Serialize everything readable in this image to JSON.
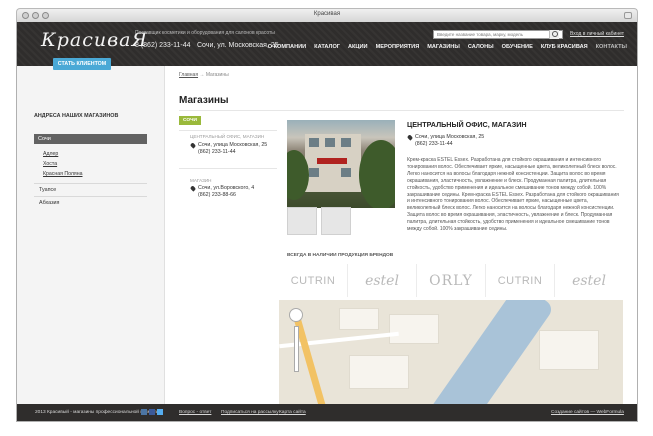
{
  "browser": {
    "title": "Красивая"
  },
  "header": {
    "logo": "КрасиваЯ",
    "tagline": "Поставщик косметики и оборудования для салонов красоты",
    "phone": "8 (862) 233-11-44",
    "address": "Сочи, ул. Московская, 25",
    "search_placeholder": "Введите название товара, марку, модель",
    "login_link": "Вход в личный кабинет",
    "nav": [
      "О КОМПАНИИ",
      "КАТАЛОГ",
      "АКЦИИ",
      "МЕРОПРИЯТИЯ",
      "МАГАЗИНЫ",
      "САЛОНЫ",
      "ОБУЧЕНИЕ",
      "КЛУБ КРАСИВАЯ",
      "КОНТАКТЫ"
    ]
  },
  "sidebar": {
    "become_client": "СТАТЬ КЛИЕНТОМ",
    "title": "АНДРЕСА НАШИХ МАГАЗИНОВ",
    "active_city": "Сочи",
    "sub_items": [
      "Адлер",
      "Хоста",
      "Красная Поляна"
    ],
    "cities": [
      "Туапсе",
      "Абхазия"
    ]
  },
  "main": {
    "breadcrumb_home": "Главная",
    "breadcrumb_sep": "→",
    "breadcrumb_current": "Магазины",
    "page_title": "Магазины",
    "tag": "СОЧИ",
    "offices": [
      {
        "caption": "ЦЕНТРАЛЬНЫЙ ОФИС, МАГАЗИН",
        "address": "Сочи, улица Московская, 25",
        "phone": "(862) 233-11-44"
      },
      {
        "caption": "МАГАЗИН",
        "address": "Сочи, ул.Воровского, 4",
        "phone": "(862) 233-88-66"
      }
    ],
    "detail": {
      "title": "ЦЕНТРАЛЬНЫЙ ОФИС, МАГАЗИН",
      "address": "Сочи, улица Московская, 25",
      "phone": "(862) 233-11-44",
      "description": "Крем-краска ESTEL Essex. Разработана для стойкого окрашивания и интенсивного тонирования волос. Обеспечивает яркие, насыщенные цвета, великолепный блеск волос. Легко наносится на волосы благодаря нежной консистенции. Защита волос во время окрашивания, эластичность, увлажнение и блеск. Продуманная палитра, длительная стойкость, удобство применения и идеальное смешивание тонов между собой. 100% закрашивание седины. Крем-краска ESTEL Essex. Разработана для стойкого окрашивания и интенсивного тонирования волос. Обеспечивает яркие, насыщенные цвета, великолепный блеск волос. Легко наносится на волосы благодаря нежной консистенции. Защита волос во время окрашивания, эластичность, увлажнение и блеск. Продуманная палитра, длительная стойкость, удобство применения и идеальное смешивание тонов между собой. 100% закрашивание седины."
    },
    "brands_title": "ВСЕГДА В НАЛИЧИИ ПРОДУКЦИЯ БРЕНДОВ",
    "brands": [
      "CUTRIN",
      "estel",
      "ORLY",
      "CUTRIN",
      "estel"
    ]
  },
  "footer": {
    "copyright": "2013 Красивый - магазины профессиональной косметики",
    "question": "Вопрос - ответ",
    "subscribe": "Подписаться на рассылку",
    "sitemap": "Карта сайта",
    "credit": "Создание сайтов — WebFormula"
  },
  "colors": {
    "header_bg": "#2f2d2c",
    "accent_blue": "#4aa9d6",
    "tag_green": "#9ab93b"
  }
}
